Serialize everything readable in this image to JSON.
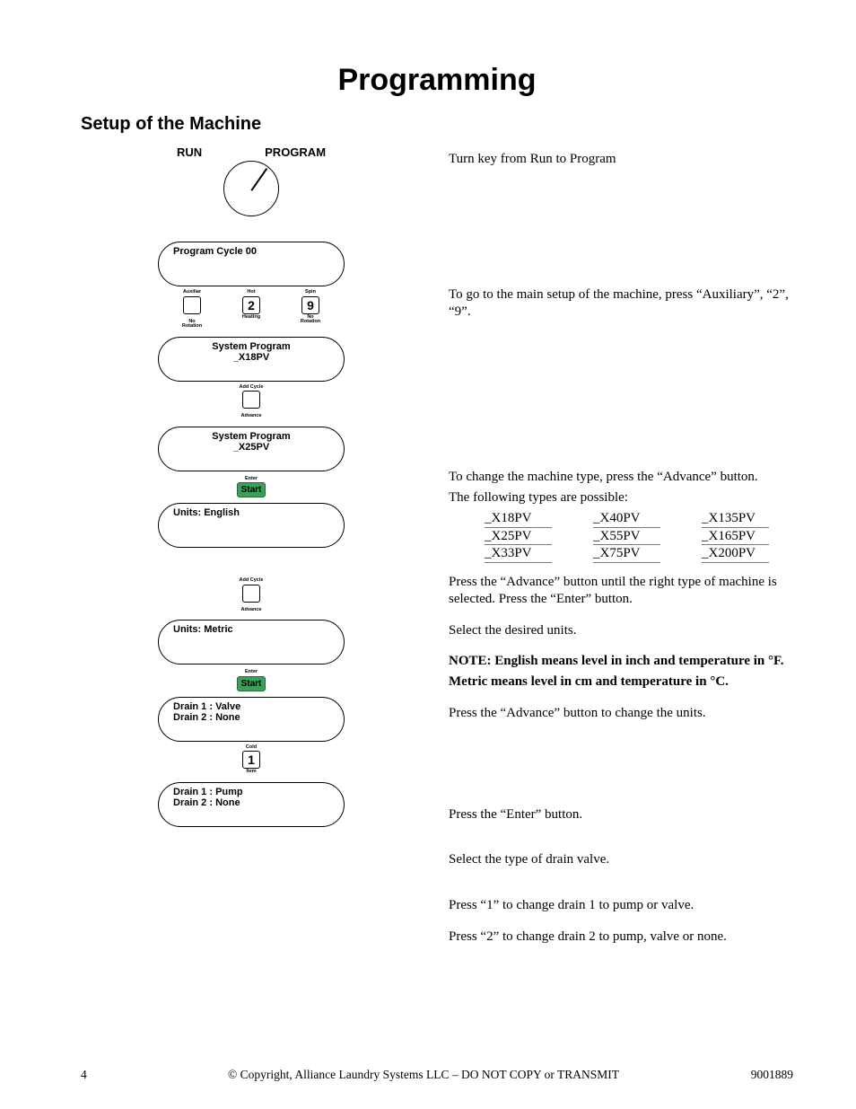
{
  "title": "Programming",
  "section": "Setup of the Machine",
  "key": {
    "run": "RUN",
    "program": "PROGRAM"
  },
  "displays": {
    "d1": "Program Cycle 00",
    "d2a": "System Program",
    "d2b": "_X18PV",
    "d3a": "System Program",
    "d3b": "_X25PV",
    "d4": "Units: English",
    "d5": "Units: Metric",
    "d6a": "Drain 1 : Valve",
    "d6b": "Drain 2 : None",
    "d7a": "Drain 1 : Pump",
    "d7b": "Drain 2 : None"
  },
  "buttons": {
    "aux_top": "Auxiliar",
    "aux_bot": "No Rotation",
    "aux_key": " ",
    "two_top": "Hot",
    "two_bot": "Heating",
    "two_key": "2",
    "nine_top": "Spin",
    "nine_bot": "No Rotation",
    "nine_key": "9",
    "adv_top": "Add Cycle",
    "adv_bot": "Advance",
    "adv_key": " ",
    "start_top": "Enter",
    "start_key": "Start",
    "one_top": "Cold",
    "one_bot": "Item",
    "one_key": "1"
  },
  "right": {
    "p1": "Turn key from Run to Program",
    "p2": "To go to the main setup of the machine, press “Auxiliary”, “2”, “9”.",
    "p3": "To change the machine type, press the “Advance” button.",
    "p4": "The following types are possible:",
    "p5": "Press the “Advance” button until the right type of machine is selected. Press the “Enter” button.",
    "p6": "Select the desired units.",
    "note1": "NOTE: English means level in inch and temperature in °F.",
    "note2": "Metric means level in cm and temperature in °C.",
    "p7": "Press the “Advance” button to change the units.",
    "p8": "Press the “Enter” button.",
    "p9": "Select the type of drain valve.",
    "p10": "Press “1” to change drain 1 to pump or valve.",
    "p11": "Press “2” to change drain 2 to pump, valve or none."
  },
  "types": {
    "c1": [
      "_X18PV",
      "_X25PV",
      "_X33PV"
    ],
    "c2": [
      "_X40PV",
      "_X55PV",
      "_X75PV"
    ],
    "c3": [
      "_X135PV",
      "_X165PV",
      "_X200PV"
    ]
  },
  "footer": {
    "page": "4",
    "copyright": "© Copyright, Alliance Laundry Systems LLC – DO NOT COPY or TRANSMIT",
    "docnum": "9001889"
  }
}
